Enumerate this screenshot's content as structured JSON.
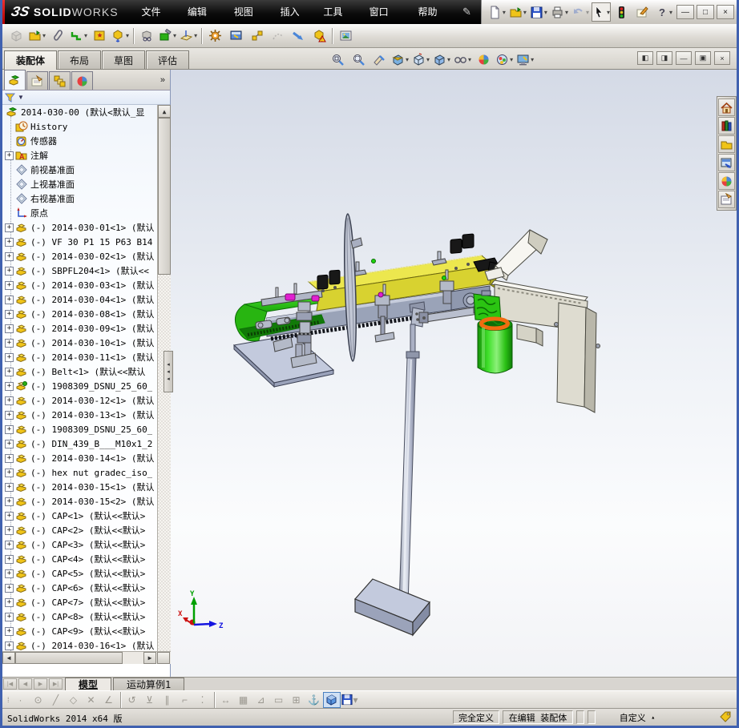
{
  "titlebar": {
    "brand": {
      "logo": "ЗS",
      "solid": "SOLID",
      "works": "WORKS"
    },
    "menus": [
      "文件(F)",
      "编辑(E)",
      "视图(V)",
      "插入(I)",
      "工具(T)",
      "窗口(W)",
      "帮助(H)"
    ],
    "pin_icon": "pin-icon",
    "quick_tools": [
      {
        "name": "new-document-button",
        "icon": "newdoc",
        "dropdown": true
      },
      {
        "name": "open-button",
        "icon": "open",
        "dropdown": true
      },
      {
        "name": "save-button",
        "icon": "save",
        "dropdown": true
      },
      {
        "name": "print-button",
        "icon": "print",
        "dropdown": true
      },
      {
        "name": "undo-button",
        "icon": "undo",
        "dropdown": true,
        "disabled": true
      },
      {
        "name": "select-button",
        "icon": "select",
        "dropdown": true,
        "boxed": true
      },
      {
        "name": "rebuild-button",
        "icon": "traffic"
      },
      {
        "name": "options-button",
        "icon": "options"
      },
      {
        "name": "help-button",
        "icon": "help",
        "dropdown": true
      }
    ],
    "window_buttons": [
      {
        "name": "minimize-button",
        "glyph": "—"
      },
      {
        "name": "restore-button",
        "glyph": "□"
      },
      {
        "name": "close-button",
        "glyph": "×"
      }
    ]
  },
  "toolbar2": {
    "tools": [
      {
        "name": "insert-component-button",
        "icon": "cube-gray",
        "disabled": true
      },
      {
        "name": "open-part-button",
        "icon": "open",
        "dropdown": true
      },
      {
        "name": "attachment-button",
        "icon": "clip"
      },
      {
        "name": "mate-button",
        "icon": "mate",
        "dropdown": true
      },
      {
        "name": "component-pattern-button",
        "icon": "pattern"
      },
      {
        "name": "move-component-button",
        "icon": "move",
        "dropdown": true
      },
      {
        "sep": true
      },
      {
        "name": "show-hidden-components-button",
        "icon": "showhide"
      },
      {
        "name": "assembly-features-button",
        "icon": "asmfeat",
        "dropdown": true
      },
      {
        "name": "reference-geometry-button",
        "icon": "refgeo",
        "dropdown": true
      },
      {
        "sep": true
      },
      {
        "name": "motion-study-button",
        "icon": "gear"
      },
      {
        "name": "large-design-review-button",
        "icon": "review"
      },
      {
        "name": "exploded-view-button",
        "icon": "explode"
      },
      {
        "name": "explode-line-sketch-button",
        "icon": "explline",
        "disabled": true
      },
      {
        "name": "curve-arrow-button",
        "icon": "bluearrow"
      },
      {
        "name": "interference-check-button",
        "icon": "interfere"
      },
      {
        "sep": true
      },
      {
        "name": "preview-window-button",
        "icon": "picture"
      }
    ]
  },
  "command_bar": {
    "tabs": [
      {
        "label": "装配体",
        "active": true
      },
      {
        "label": "布局",
        "active": false
      },
      {
        "label": "草图",
        "active": false
      },
      {
        "label": "评估",
        "active": false
      }
    ],
    "headsup": [
      {
        "name": "zoom-fit-button",
        "icon": "zoomfit"
      },
      {
        "name": "zoom-area-button",
        "icon": "zoomarea"
      },
      {
        "name": "previous-view-button",
        "icon": "zoompen"
      },
      {
        "name": "section-view-button",
        "icon": "section",
        "dropdown": true
      },
      {
        "name": "view-orientation-button",
        "icon": "viewcube",
        "dropdown": true
      },
      {
        "name": "display-style-button",
        "icon": "dispstyle",
        "dropdown": true
      },
      {
        "name": "hide-show-items-button",
        "icon": "glasses",
        "dropdown": true
      },
      {
        "name": "edit-appearance-button",
        "icon": "sphere"
      },
      {
        "name": "apply-scene-button",
        "icon": "scene",
        "dropdown": true
      },
      {
        "name": "view-settings-button",
        "icon": "monitor",
        "dropdown": true
      }
    ],
    "doc_buttons": [
      {
        "name": "pane-left-button",
        "glyph": "◧"
      },
      {
        "name": "pane-right-button",
        "glyph": "◨"
      },
      {
        "name": "doc-minimize-button",
        "glyph": "—"
      },
      {
        "name": "doc-restore-button",
        "glyph": "▣"
      },
      {
        "name": "doc-close-button",
        "glyph": "×"
      }
    ]
  },
  "panel": {
    "tabs": [
      {
        "name": "tab-featuremanager",
        "icon": "ft-asm",
        "active": true
      },
      {
        "name": "tab-propertymanager",
        "icon": "ft-prop",
        "active": false
      },
      {
        "name": "tab-configurationmanager",
        "icon": "ft-config",
        "active": false
      },
      {
        "name": "tab-displaymanager",
        "icon": "ft-display",
        "active": false
      }
    ],
    "chevron": "»",
    "tree": {
      "items": [
        {
          "icon": "root",
          "label": "2014-030-00 (默认<默认_显",
          "root": true
        },
        {
          "icon": "history",
          "label": "History"
        },
        {
          "icon": "sensor",
          "label": "传感器"
        },
        {
          "icon": "annot",
          "label": "注解",
          "expand": true
        },
        {
          "icon": "plane",
          "label": "前视基准面"
        },
        {
          "icon": "plane",
          "label": "上视基准面"
        },
        {
          "icon": "plane",
          "label": "右视基准面"
        },
        {
          "icon": "origin",
          "label": "原点"
        },
        {
          "icon": "part",
          "expand": true,
          "label": "(-) 2014-030-01<1> (默认"
        },
        {
          "icon": "part",
          "expand": true,
          "label": "(-) VF 30 P1 15 P63 B14"
        },
        {
          "icon": "part",
          "expand": true,
          "label": "(-) 2014-030-02<1> (默认"
        },
        {
          "icon": "part",
          "expand": true,
          "label": "(-) SBPFL204<1> (默认<<"
        },
        {
          "icon": "part",
          "expand": true,
          "label": "(-) 2014-030-03<1> (默认"
        },
        {
          "icon": "part",
          "expand": true,
          "label": "(-) 2014-030-04<1> (默认"
        },
        {
          "icon": "part",
          "expand": true,
          "label": "(-) 2014-030-08<1> (默认"
        },
        {
          "icon": "part",
          "expand": true,
          "label": "(-) 2014-030-09<1> (默认"
        },
        {
          "icon": "part",
          "expand": true,
          "label": "(-) 2014-030-10<1> (默认"
        },
        {
          "icon": "part",
          "expand": true,
          "label": "(-) 2014-030-11<1> (默认"
        },
        {
          "icon": "part",
          "expand": true,
          "label": "(-) Belt<1> (默认<<默认"
        },
        {
          "icon": "subasm",
          "expand": true,
          "label": "(-) 1908309_DSNU_25_60_"
        },
        {
          "icon": "part",
          "expand": true,
          "label": "(-) 2014-030-12<1> (默认"
        },
        {
          "icon": "part",
          "expand": true,
          "label": "(-) 2014-030-13<1> (默认"
        },
        {
          "icon": "part",
          "expand": true,
          "label": "(-) 1908309_DSNU_25_60_"
        },
        {
          "icon": "part",
          "expand": true,
          "label": "(-) DIN_439_B___M10x1_2"
        },
        {
          "icon": "part",
          "expand": true,
          "label": "(-) 2014-030-14<1> (默认"
        },
        {
          "icon": "part",
          "expand": true,
          "label": "(-) hex nut gradec_iso_"
        },
        {
          "icon": "part",
          "expand": true,
          "label": "(-) 2014-030-15<1> (默认"
        },
        {
          "icon": "part",
          "expand": true,
          "label": "(-) 2014-030-15<2> (默认"
        },
        {
          "icon": "part",
          "expand": true,
          "label": "(-) CAP<1> (默认<<默认>"
        },
        {
          "icon": "part",
          "expand": true,
          "label": "(-) CAP<2> (默认<<默认>"
        },
        {
          "icon": "part",
          "expand": true,
          "label": "(-) CAP<3> (默认<<默认>"
        },
        {
          "icon": "part",
          "expand": true,
          "label": "(-) CAP<4> (默认<<默认>"
        },
        {
          "icon": "part",
          "expand": true,
          "label": "(-) CAP<5> (默认<<默认>"
        },
        {
          "icon": "part",
          "expand": true,
          "label": "(-) CAP<6> (默认<<默认>"
        },
        {
          "icon": "part",
          "expand": true,
          "label": "(-) CAP<7> (默认<<默认>"
        },
        {
          "icon": "part",
          "expand": true,
          "label": "(-) CAP<8> (默认<<默认>"
        },
        {
          "icon": "part",
          "expand": true,
          "label": "(-) CAP<9> (默认<<默认>"
        },
        {
          "icon": "part",
          "expand": true,
          "label": "(-) 2014-030-16<1> (默认"
        },
        {
          "icon": "part",
          "expand": true,
          "label": "(-)"
        }
      ]
    }
  },
  "taskpane": {
    "tabs": [
      {
        "name": "taskpane-home",
        "icon": "tp-home"
      },
      {
        "name": "taskpane-design-library",
        "icon": "tp-lib"
      },
      {
        "name": "taskpane-file-explorer",
        "icon": "tp-folder"
      },
      {
        "name": "taskpane-view-palette",
        "icon": "tp-palette"
      },
      {
        "name": "taskpane-appearances",
        "icon": "tp-sphere"
      },
      {
        "name": "taskpane-custom-properties",
        "icon": "tp-props"
      }
    ]
  },
  "bottom": {
    "nav": [
      "|◀",
      "◀",
      "▶",
      "▶|"
    ],
    "tabs": [
      {
        "label": "模型",
        "active": true
      },
      {
        "label": "运动算例1",
        "active": false
      }
    ]
  },
  "sketchbar": {
    "tools": [
      {
        "name": "point-tool",
        "glyph": "·"
      },
      {
        "name": "circle-tool",
        "glyph": "⊙"
      },
      {
        "name": "line-tool",
        "glyph": "╱"
      },
      {
        "name": "polygon-tool",
        "glyph": "◇"
      },
      {
        "name": "trim-tool",
        "glyph": "✕"
      },
      {
        "name": "angle-tool",
        "glyph": "∠"
      },
      {
        "sep": true
      },
      {
        "name": "mirror-tool",
        "glyph": "↺"
      },
      {
        "name": "offset-tool",
        "glyph": "⊻"
      },
      {
        "name": "parallel-tool",
        "glyph": "∥"
      },
      {
        "name": "corner-tool",
        "glyph": "⌐"
      },
      {
        "name": "spline-tool",
        "glyph": "⁚"
      },
      {
        "sep": true
      },
      {
        "name": "dimension-tool",
        "glyph": "↔"
      },
      {
        "name": "grid-tool",
        "glyph": "▦"
      },
      {
        "name": "angle-snap-tool",
        "glyph": "⊿"
      },
      {
        "name": "rectangle-tool",
        "glyph": "▭"
      },
      {
        "name": "table-tool",
        "glyph": "⊞"
      },
      {
        "name": "anchor-tool",
        "glyph": "⚓",
        "colored": true
      },
      {
        "name": "shaded-view-button",
        "icon": "bluecube",
        "active": true
      },
      {
        "name": "save-small-button",
        "icon": "save",
        "dropdown": true
      }
    ]
  },
  "statusbar": {
    "left": "SolidWorks 2014 x64 版",
    "defined": "完全定义",
    "editing": "在编辑 装配体",
    "custom": "自定义",
    "custom_arrow": "▴",
    "tag_icon": "tag-icon"
  },
  "viewport": {
    "triad": {
      "x": "X",
      "y": "Y",
      "z": "Z"
    },
    "colors": {
      "conveyor_yellow": "#e4de3c",
      "belt_green": "#2ec714",
      "cylinder_green": "#2ad114",
      "ring_orange": "#f06c10",
      "bracket_white": "#efeee6",
      "frame_gray": "#9aa3b8",
      "plate_lavender": "#c3cadd",
      "clamp_black": "#181818",
      "accent_magenta": "#e020d0"
    }
  }
}
